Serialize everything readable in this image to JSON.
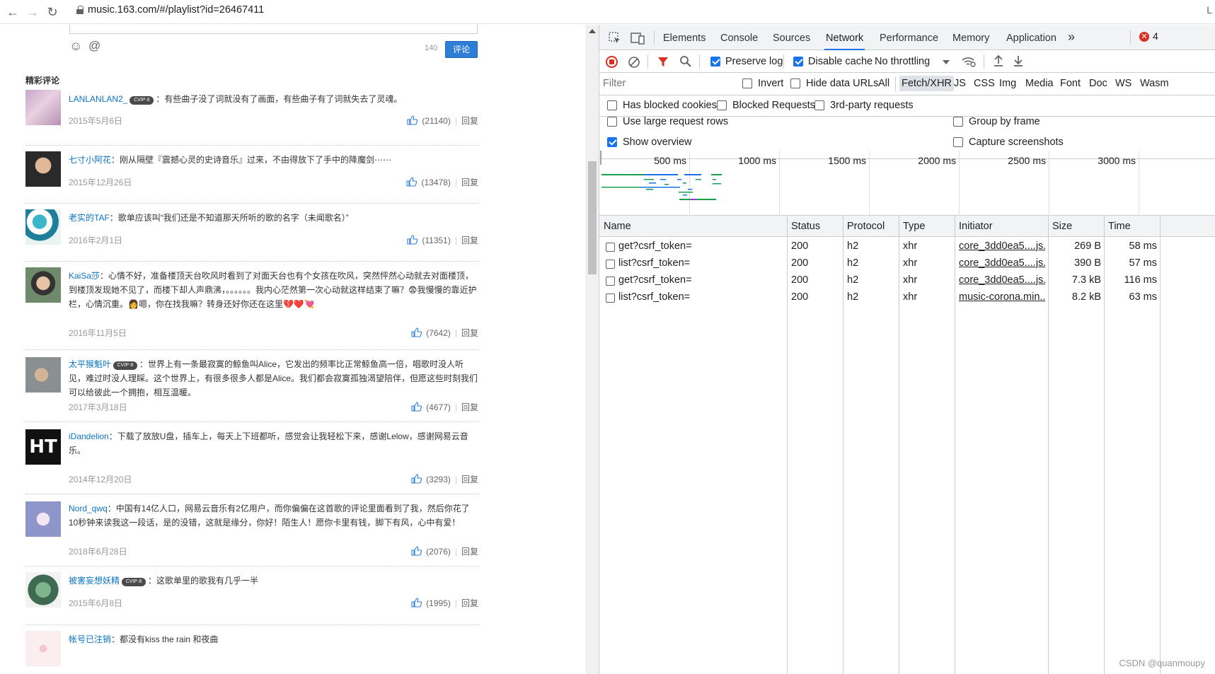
{
  "browser": {
    "url": "music.163.com/#/playlist?id=26467411",
    "right_glyph": "L"
  },
  "page": {
    "char_count": "140",
    "comment_button": "评论",
    "section_title": "精彩评论",
    "comments": [
      {
        "user": "LANLANLAN2_",
        "vip": true,
        "text": "有些曲子没了词就没有了画面，有些曲子有了词就失去了灵魂。",
        "date": "2015年5月6日",
        "likes": "(21140)",
        "reply": "回复"
      },
      {
        "user": "七寸小阿花",
        "vip": false,
        "text": "刚从隔壁『震撼心灵的史诗音乐』过来，不由得放下了手中的降魔剑⋯⋯",
        "date": "2015年12月26日",
        "likes": "(13478)",
        "reply": "回复"
      },
      {
        "user": "老实的TAF",
        "vip": false,
        "text": "歌单应该叫“我们还是不知道那天所听的歌的名字（未闻歌名）”",
        "date": "2016年2月1日",
        "likes": "(11351)",
        "reply": "回复"
      },
      {
        "user": "KaiSa莎",
        "vip": false,
        "text": "心情不好，准备楼顶天台吹风时看到了对面天台也有个女孩在吹风，突然怦然心动就去对面楼顶，到楼顶发现她不见了，而楼下却人声鼎沸，。。。。。。我内心茫然第一次心动就这样结束了嘛？😨我慢慢的靠近护栏，心情沉重。👩嗯，你在找我嘛？转身还好你还在这里💔❤️💘",
        "date": "2016年11月5日",
        "likes": "(7642)",
        "reply": "回复"
      },
      {
        "user": "太平猴魁叶",
        "vip": true,
        "text": "世界上有一条最寂寞的鲸鱼叫Alice，它发出的频率比正常鲸鱼高一倍，唱歌时没人听见，难过时没人理睬。这个世界上，有很多很多人都是Alice。我们都会寂寞孤独渴望陪伴，但愿这些时刻我们可以给彼此一个拥抱，相互温暖。",
        "date": "2017年3月18日",
        "likes": "(4677)",
        "reply": "回复"
      },
      {
        "user": "iDandelion",
        "vip": false,
        "text": "下载了放放U盘，插车上，每天上下班都听，感觉会让我轻松下来，感谢Lelow，感谢网易云音乐。",
        "date": "2014年12月20日",
        "likes": "(3293)",
        "reply": "回复"
      },
      {
        "user": "Nord_qwq",
        "vip": false,
        "text": "中国有14亿人口，网易云音乐有2亿用户，而你偏偏在这首歌的评论里面看到了我，然后你花了10秒钟来读我这一段话，是的没错，这就是缘分，你好！陌生人！愿你卡里有钱，脚下有风，心中有爱！",
        "date": "2018年6月28日",
        "likes": "(2076)",
        "reply": "回复"
      },
      {
        "user": "被害妄想妖精",
        "vip": true,
        "text": "这歌单里的歌我有几乎一半",
        "date": "2015年6月8日",
        "likes": "(1995)",
        "reply": "回复"
      },
      {
        "user": "帐号已注销",
        "vip": false,
        "text": "都没有kiss the rain 和夜曲",
        "date": "",
        "likes": "",
        "reply": ""
      }
    ],
    "avatar_text_ht": "HT",
    "vip_badge": "CVIP·8"
  },
  "devtools": {
    "tabs": [
      "Elements",
      "Console",
      "Sources",
      "Network",
      "Performance",
      "Memory",
      "Application"
    ],
    "active_tab": "Network",
    "more_tabs": "»",
    "error_count": "4",
    "toolbar": {
      "preserve_log": "Preserve log",
      "disable_cache": "Disable cache",
      "throttling": "No throttling"
    },
    "filter": {
      "placeholder": "Filter",
      "invert": "Invert",
      "hide_data_urls": "Hide data URLs",
      "types": [
        "All",
        "Fetch/XHR",
        "JS",
        "CSS",
        "Img",
        "Media",
        "Font",
        "Doc",
        "WS",
        "Wasm"
      ],
      "active_type": "Fetch/XHR"
    },
    "checks": {
      "has_blocked_cookies": "Has blocked cookies",
      "blocked_requests": "Blocked Requests",
      "third_party": "3rd-party requests",
      "large_rows": "Use large request rows",
      "show_overview": "Show overview",
      "group_by_frame": "Group by frame",
      "capture_screenshots": "Capture screenshots"
    },
    "overview_ticks": [
      "500 ms",
      "1000 ms",
      "1500 ms",
      "2000 ms",
      "2500 ms",
      "3000 ms"
    ],
    "columns": [
      "Name",
      "Status",
      "Protocol",
      "Type",
      "Initiator",
      "Size",
      "Time"
    ],
    "rows": [
      {
        "name": "get?csrf_token=",
        "status": "200",
        "protocol": "h2",
        "type": "xhr",
        "initiator": "core_3dd0ea5....js...",
        "size": "269 B",
        "time": "58 ms"
      },
      {
        "name": "list?csrf_token=",
        "status": "200",
        "protocol": "h2",
        "type": "xhr",
        "initiator": "core_3dd0ea5....js...",
        "size": "390 B",
        "time": "57 ms"
      },
      {
        "name": "get?csrf_token=",
        "status": "200",
        "protocol": "h2",
        "type": "xhr",
        "initiator": "core_3dd0ea5....js...",
        "size": "7.3 kB",
        "time": "116 ms"
      },
      {
        "name": "list?csrf_token=",
        "status": "200",
        "protocol": "h2",
        "type": "xhr",
        "initiator": "music-corona.min....",
        "size": "8.2 kB",
        "time": "63 ms"
      }
    ]
  },
  "watermark": "CSDN @quanmoupy",
  "colors": {
    "accent": "#1a73e8",
    "link": "#0c73c2",
    "comment_button": "#2e7dd7",
    "record": "#d93025"
  }
}
